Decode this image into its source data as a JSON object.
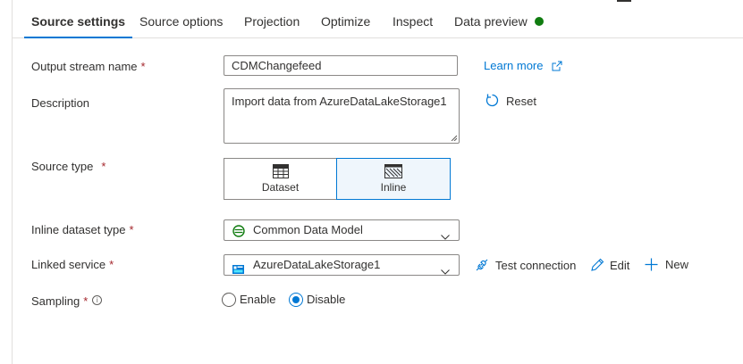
{
  "tabs": [
    {
      "label": "Source settings",
      "active": true
    },
    {
      "label": "Source options"
    },
    {
      "label": "Projection"
    },
    {
      "label": "Optimize"
    },
    {
      "label": "Inspect"
    },
    {
      "label": "Data preview",
      "status_color": "#107c10"
    }
  ],
  "form": {
    "output_stream_name": {
      "label": "Output stream name",
      "value": "CDMChangefeed"
    },
    "description": {
      "label": "Description",
      "value": "Import data from AzureDataLakeStorage1"
    },
    "source_type": {
      "label": "Source type",
      "options": [
        "Dataset",
        "Inline"
      ],
      "selected": "Inline"
    },
    "inline_dataset_type": {
      "label": "Inline dataset type",
      "value": "Common Data Model"
    },
    "linked_service": {
      "label": "Linked service",
      "value": "AzureDataLakeStorage1"
    },
    "sampling": {
      "label": "Sampling",
      "options": [
        "Enable",
        "Disable"
      ],
      "selected": "Disable"
    },
    "required_marker": "*"
  },
  "actions": {
    "learn_more": "Learn more",
    "reset": "Reset",
    "test_connection": "Test connection",
    "edit": "Edit",
    "new": "New"
  },
  "colors": {
    "accent": "#0078d4",
    "required": "#a4262c",
    "status_ok": "#107c10"
  }
}
